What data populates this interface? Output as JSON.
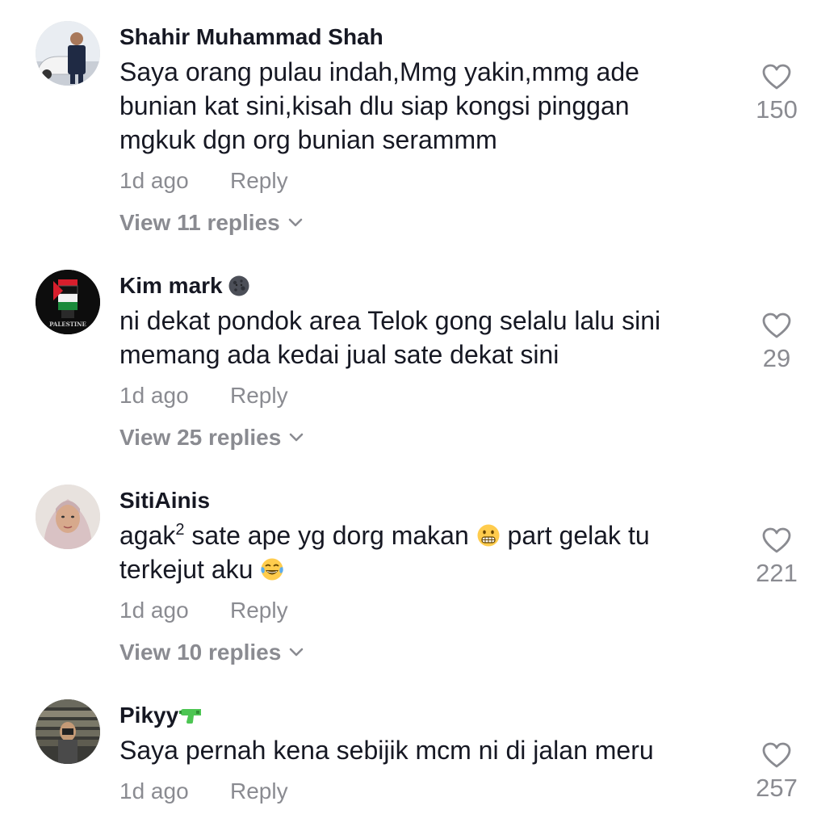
{
  "comments": [
    {
      "username": "Shahir Muhammad Shah",
      "text": "Saya orang pulau indah,Mmg yakin,mmg ade\nbunian kat sini,kisah dlu siap kongsi pinggan\nmgkuk dgn org bunian serammm",
      "time": "1d ago",
      "reply_label": "Reply",
      "view_replies": "View 11 replies",
      "likes": "150"
    },
    {
      "username": "Kim mark",
      "badge_icon": "new-moon-face-emoji",
      "text": "ni dekat pondok area Telok gong selalu lalu sini\nmemang ada kedai jual sate dekat sini",
      "time": "1d ago",
      "reply_label": "Reply",
      "view_replies": "View 25 replies",
      "likes": "29",
      "avatar_text": "PALESTINE"
    },
    {
      "username": "SitiAinis",
      "text_part1": "agak",
      "text_sup": "2",
      "text_part2": " sate ape yg dorg makan ",
      "text_part3": " part gelak tu",
      "text_line2": "terkejut aku ",
      "time": "1d ago",
      "reply_label": "Reply",
      "view_replies": "View 10 replies",
      "likes": "221"
    },
    {
      "username": "Pikyy",
      "badge_icon": "water-pistol-emoji",
      "text": "Saya pernah kena sebijik mcm ni di jalan meru",
      "time": "1d ago",
      "reply_label": "Reply",
      "likes": "257"
    }
  ],
  "colors": {
    "text": "#161823",
    "secondary": "#8a8b91"
  }
}
